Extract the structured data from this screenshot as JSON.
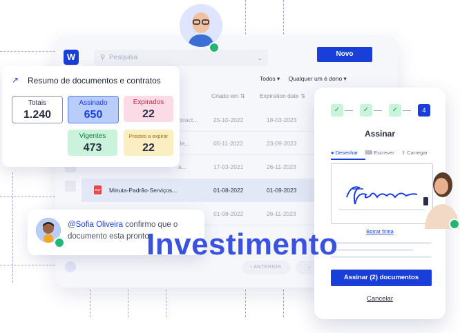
{
  "app": {
    "logo_text": "W",
    "search_placeholder": "Pesquisa",
    "new_button": "Novo",
    "filters": [
      "Todos ▾",
      "Qualquer um é dono ▾"
    ],
    "columns": [
      "Criado em",
      "Expiration date"
    ],
    "rows": [
      {
        "name": "ntract...",
        "created": "25-10-2022",
        "expires": "18-03-2023",
        "selected": false
      },
      {
        "name": "de...",
        "created": "05-11-2022",
        "expires": "23-09-2023",
        "selected": false
      },
      {
        "name": "a...",
        "created": "17-03-2021",
        "expires": "26-11-2023",
        "selected": false
      },
      {
        "name": "Minuta-Padrão-Serviços...",
        "created": "01-08-2022",
        "expires": "01-09-2023",
        "selected": true
      },
      {
        "name": "",
        "created": "01-08-2022",
        "expires": "26-11-2023",
        "selected": false
      }
    ],
    "pager_prev": "‹ ANTERIOR",
    "pager_next": "›"
  },
  "summary": {
    "title": "Resumo de documentos e contratos",
    "stats": {
      "totais": {
        "label": "Totais",
        "value": "1.240"
      },
      "assinado": {
        "label": "Assinado",
        "value": "650"
      },
      "expirados": {
        "label": "Expirados",
        "value": "22"
      },
      "vigentes": {
        "label": "Vigentes",
        "value": "473"
      },
      "prestes": {
        "label": "Prestes a expirar",
        "value": "22"
      }
    }
  },
  "comment": {
    "mention": "@Sofia Oliveira",
    "text": " confirmo que o documento esta pronto"
  },
  "overlay_word": "Investimento",
  "sign": {
    "steps": [
      "✓",
      "✓",
      "✓",
      "4"
    ],
    "title": "Assinar",
    "tabs": [
      "Desenhar",
      "Escrever",
      "Carregar"
    ],
    "clear_link": "Borrar firma",
    "sign_button": "Assinar (2) documentos",
    "cancel": "Cancelar"
  },
  "colors": {
    "brand": "#1a3fd9",
    "assinado_bg": "#b9cdfa",
    "expirados_bg": "#fbdbe6",
    "vigentes_bg": "#c9f3da",
    "prestes_bg": "#fbeec0",
    "online": "#22b573"
  }
}
